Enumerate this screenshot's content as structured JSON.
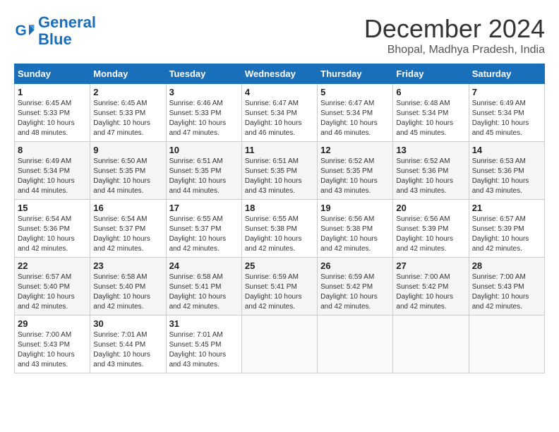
{
  "header": {
    "logo_line1": "General",
    "logo_line2": "Blue",
    "month_title": "December 2024",
    "location": "Bhopal, Madhya Pradesh, India"
  },
  "days_of_week": [
    "Sunday",
    "Monday",
    "Tuesday",
    "Wednesday",
    "Thursday",
    "Friday",
    "Saturday"
  ],
  "weeks": [
    [
      {
        "day": "1",
        "sunrise": "6:45 AM",
        "sunset": "5:33 PM",
        "daylight": "10 hours and 48 minutes."
      },
      {
        "day": "2",
        "sunrise": "6:45 AM",
        "sunset": "5:33 PM",
        "daylight": "10 hours and 47 minutes."
      },
      {
        "day": "3",
        "sunrise": "6:46 AM",
        "sunset": "5:33 PM",
        "daylight": "10 hours and 47 minutes."
      },
      {
        "day": "4",
        "sunrise": "6:47 AM",
        "sunset": "5:34 PM",
        "daylight": "10 hours and 46 minutes."
      },
      {
        "day": "5",
        "sunrise": "6:47 AM",
        "sunset": "5:34 PM",
        "daylight": "10 hours and 46 minutes."
      },
      {
        "day": "6",
        "sunrise": "6:48 AM",
        "sunset": "5:34 PM",
        "daylight": "10 hours and 45 minutes."
      },
      {
        "day": "7",
        "sunrise": "6:49 AM",
        "sunset": "5:34 PM",
        "daylight": "10 hours and 45 minutes."
      }
    ],
    [
      {
        "day": "8",
        "sunrise": "6:49 AM",
        "sunset": "5:34 PM",
        "daylight": "10 hours and 44 minutes."
      },
      {
        "day": "9",
        "sunrise": "6:50 AM",
        "sunset": "5:35 PM",
        "daylight": "10 hours and 44 minutes."
      },
      {
        "day": "10",
        "sunrise": "6:51 AM",
        "sunset": "5:35 PM",
        "daylight": "10 hours and 44 minutes."
      },
      {
        "day": "11",
        "sunrise": "6:51 AM",
        "sunset": "5:35 PM",
        "daylight": "10 hours and 43 minutes."
      },
      {
        "day": "12",
        "sunrise": "6:52 AM",
        "sunset": "5:35 PM",
        "daylight": "10 hours and 43 minutes."
      },
      {
        "day": "13",
        "sunrise": "6:52 AM",
        "sunset": "5:36 PM",
        "daylight": "10 hours and 43 minutes."
      },
      {
        "day": "14",
        "sunrise": "6:53 AM",
        "sunset": "5:36 PM",
        "daylight": "10 hours and 43 minutes."
      }
    ],
    [
      {
        "day": "15",
        "sunrise": "6:54 AM",
        "sunset": "5:36 PM",
        "daylight": "10 hours and 42 minutes."
      },
      {
        "day": "16",
        "sunrise": "6:54 AM",
        "sunset": "5:37 PM",
        "daylight": "10 hours and 42 minutes."
      },
      {
        "day": "17",
        "sunrise": "6:55 AM",
        "sunset": "5:37 PM",
        "daylight": "10 hours and 42 minutes."
      },
      {
        "day": "18",
        "sunrise": "6:55 AM",
        "sunset": "5:38 PM",
        "daylight": "10 hours and 42 minutes."
      },
      {
        "day": "19",
        "sunrise": "6:56 AM",
        "sunset": "5:38 PM",
        "daylight": "10 hours and 42 minutes."
      },
      {
        "day": "20",
        "sunrise": "6:56 AM",
        "sunset": "5:39 PM",
        "daylight": "10 hours and 42 minutes."
      },
      {
        "day": "21",
        "sunrise": "6:57 AM",
        "sunset": "5:39 PM",
        "daylight": "10 hours and 42 minutes."
      }
    ],
    [
      {
        "day": "22",
        "sunrise": "6:57 AM",
        "sunset": "5:40 PM",
        "daylight": "10 hours and 42 minutes."
      },
      {
        "day": "23",
        "sunrise": "6:58 AM",
        "sunset": "5:40 PM",
        "daylight": "10 hours and 42 minutes."
      },
      {
        "day": "24",
        "sunrise": "6:58 AM",
        "sunset": "5:41 PM",
        "daylight": "10 hours and 42 minutes."
      },
      {
        "day": "25",
        "sunrise": "6:59 AM",
        "sunset": "5:41 PM",
        "daylight": "10 hours and 42 minutes."
      },
      {
        "day": "26",
        "sunrise": "6:59 AM",
        "sunset": "5:42 PM",
        "daylight": "10 hours and 42 minutes."
      },
      {
        "day": "27",
        "sunrise": "7:00 AM",
        "sunset": "5:42 PM",
        "daylight": "10 hours and 42 minutes."
      },
      {
        "day": "28",
        "sunrise": "7:00 AM",
        "sunset": "5:43 PM",
        "daylight": "10 hours and 42 minutes."
      }
    ],
    [
      {
        "day": "29",
        "sunrise": "7:00 AM",
        "sunset": "5:43 PM",
        "daylight": "10 hours and 43 minutes."
      },
      {
        "day": "30",
        "sunrise": "7:01 AM",
        "sunset": "5:44 PM",
        "daylight": "10 hours and 43 minutes."
      },
      {
        "day": "31",
        "sunrise": "7:01 AM",
        "sunset": "5:45 PM",
        "daylight": "10 hours and 43 minutes."
      },
      null,
      null,
      null,
      null
    ]
  ]
}
